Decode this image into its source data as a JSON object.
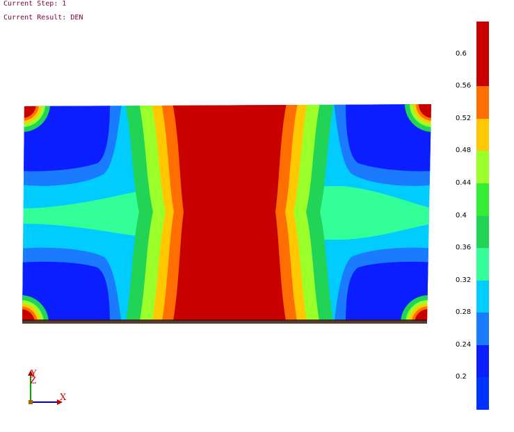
{
  "status": {
    "current_step": "Current Step: 1",
    "current_result": "Current Result: DEN"
  },
  "legend": {
    "labels": [
      "0.6",
      "0.56",
      "0.52",
      "0.48",
      "0.44",
      "0.4",
      "0.36",
      "0.32",
      "0.28",
      "0.24",
      "0.2"
    ],
    "colors": [
      "#c80000",
      "#c80000",
      "#ff6e00",
      "#ffc800",
      "#9bff2a",
      "#33ee33",
      "#22d455",
      "#33ff99",
      "#00ccff",
      "#1a7bff",
      "#0a1eff",
      "#0033ff"
    ]
  },
  "contour_colors": {
    "deep_blue": "#0a1eff",
    "blue": "#1a7bff",
    "cyan": "#00ccff",
    "aqua_green": "#33ff99",
    "green": "#22d455",
    "light_green": "#9bff2a",
    "yellow": "#ffc800",
    "orange": "#ff6e00",
    "red": "#c80000"
  },
  "axis_triad": {
    "x_label": "X",
    "y_label": "Y",
    "z_label": "Z"
  }
}
